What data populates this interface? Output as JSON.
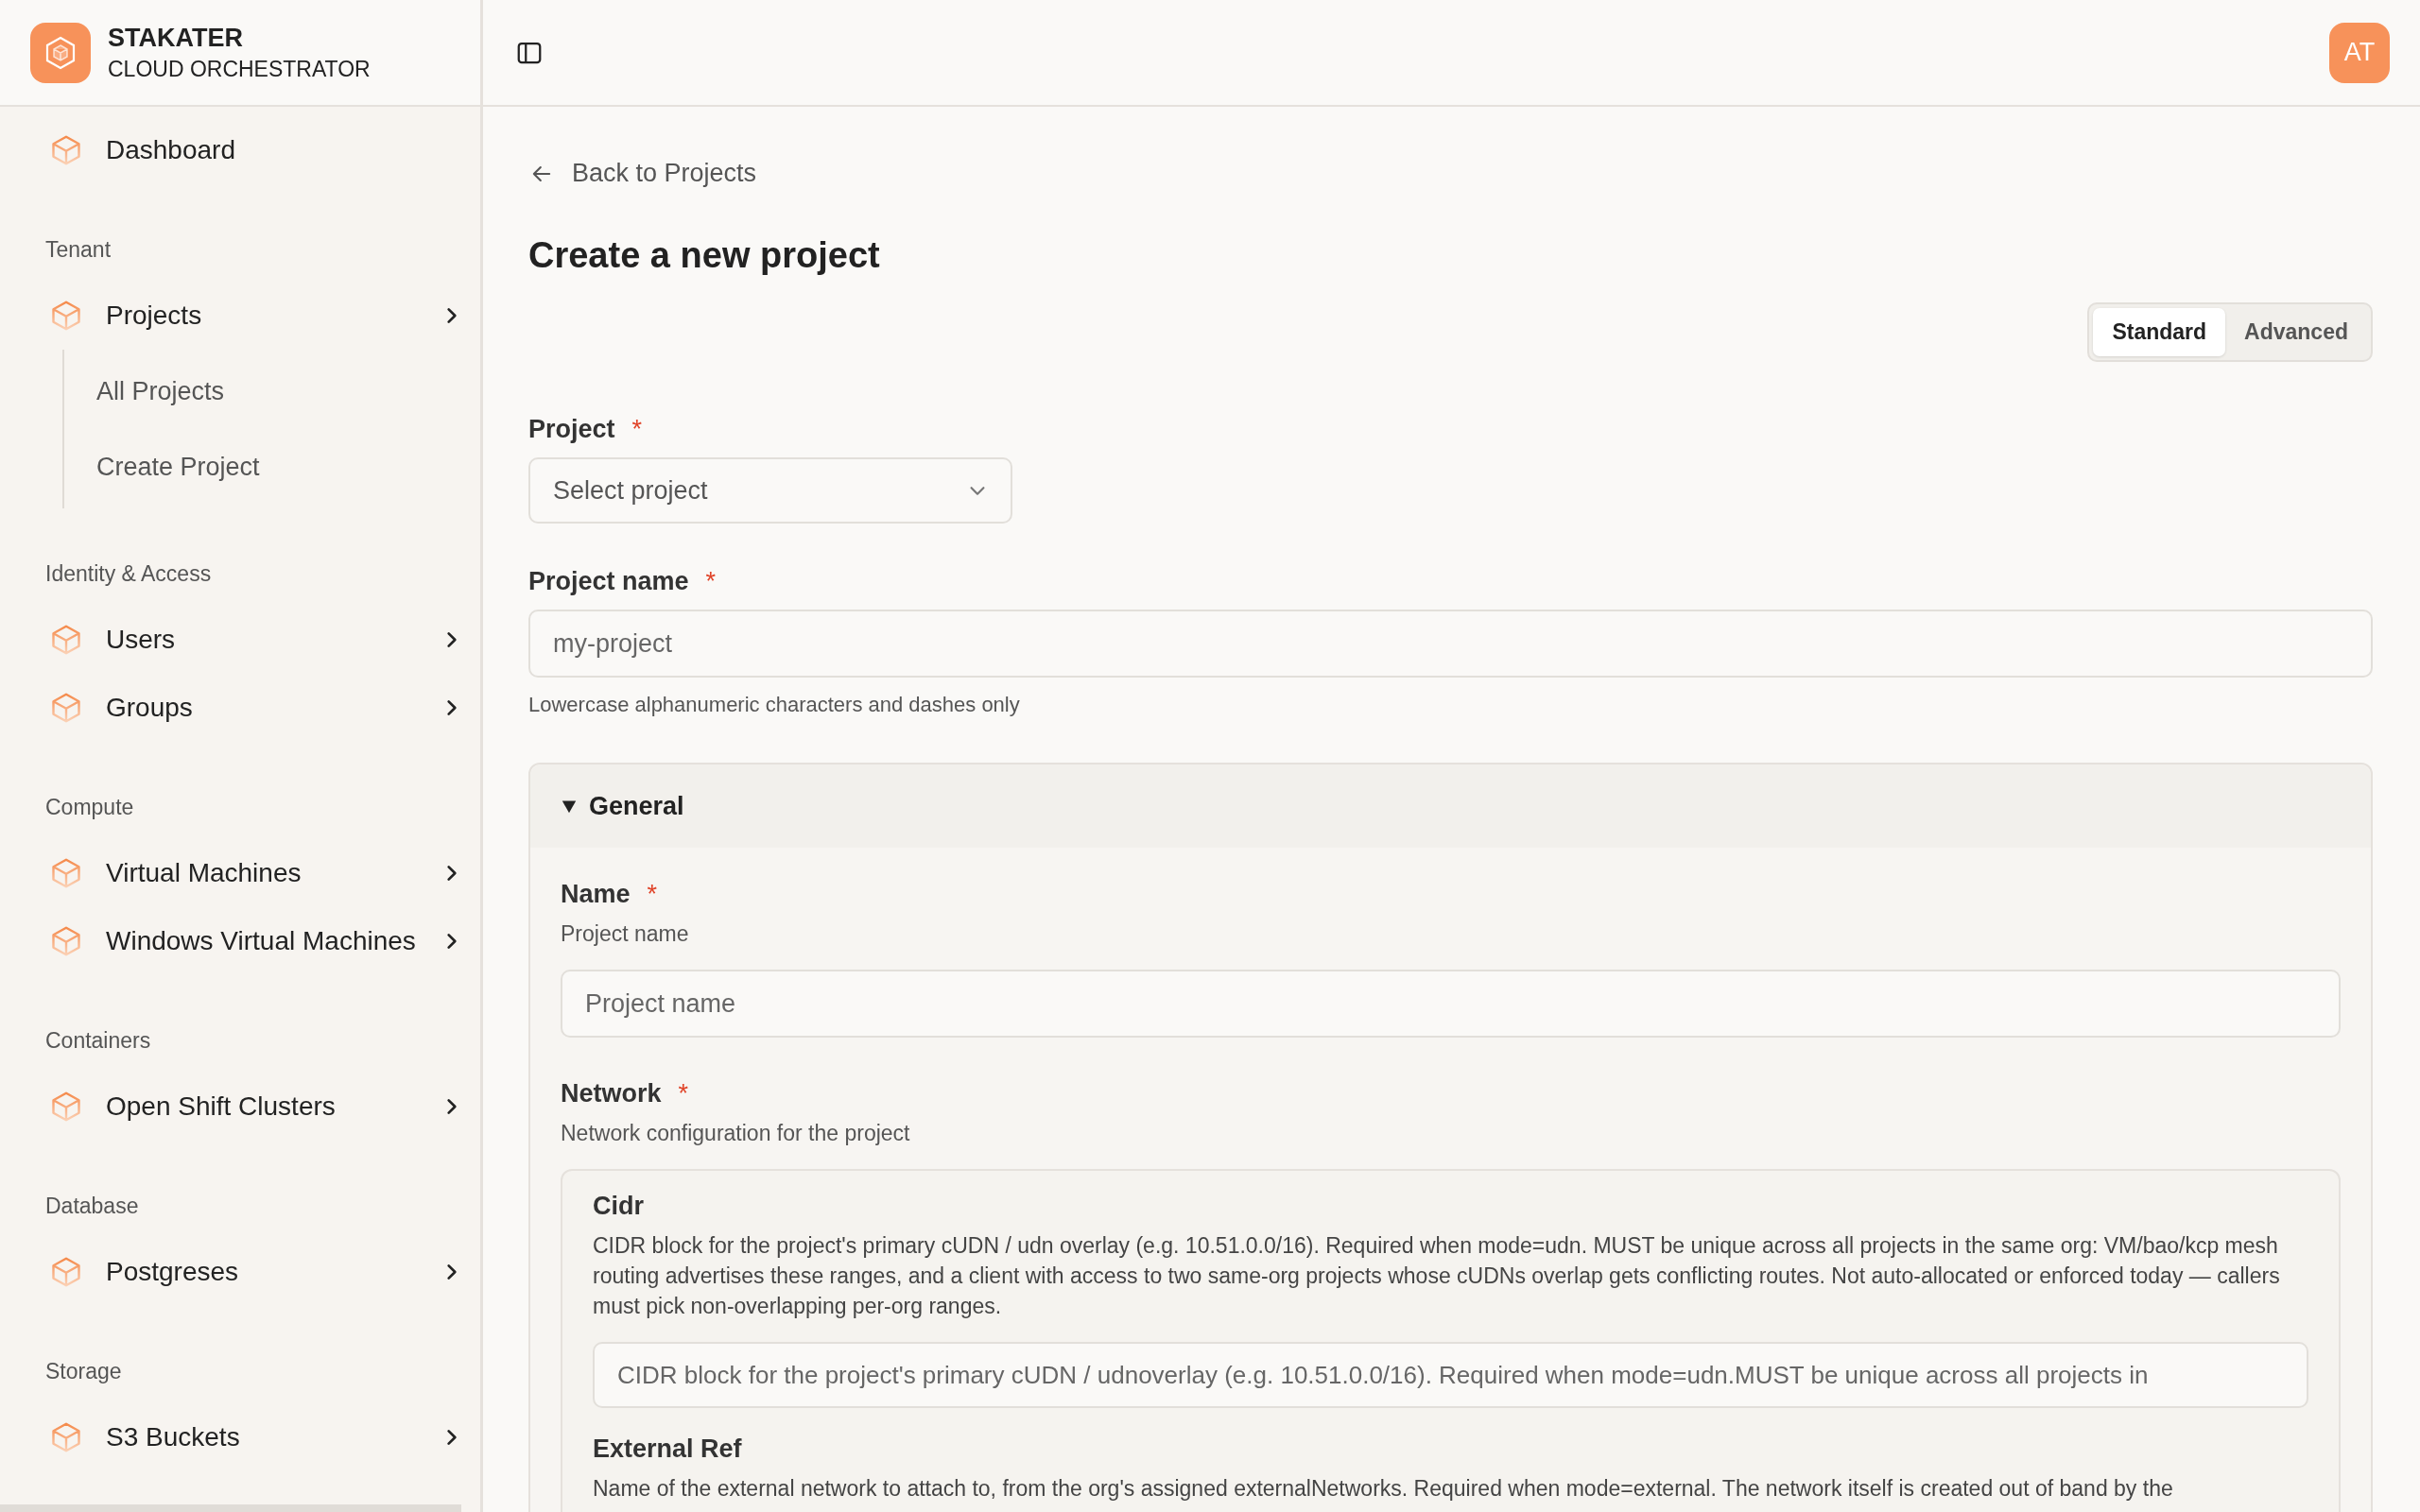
{
  "brand": {
    "title": "STAKATER",
    "subtitle": "CLOUD ORCHESTRATOR"
  },
  "avatar": {
    "initials": "AT"
  },
  "sidebar": {
    "sections": [
      {
        "items": [
          {
            "label": "Dashboard",
            "kind": "link"
          }
        ]
      },
      {
        "label": "Tenant",
        "items": [
          {
            "label": "Projects",
            "kind": "menu",
            "children": [
              {
                "label": "All Projects"
              },
              {
                "label": "Create Project"
              }
            ]
          }
        ]
      },
      {
        "label": "Identity & Access",
        "items": [
          {
            "label": "Users",
            "kind": "menu"
          },
          {
            "label": "Groups",
            "kind": "menu"
          }
        ]
      },
      {
        "label": "Compute",
        "items": [
          {
            "label": "Virtual Machines",
            "kind": "menu"
          },
          {
            "label": "Windows Virtual Machines",
            "kind": "menu"
          }
        ]
      },
      {
        "label": "Containers",
        "items": [
          {
            "label": "Open Shift Clusters",
            "kind": "menu"
          }
        ]
      },
      {
        "label": "Database",
        "items": [
          {
            "label": "Postgreses",
            "kind": "menu"
          }
        ]
      },
      {
        "label": "Storage",
        "items": [
          {
            "label": "S3 Buckets",
            "kind": "menu"
          }
        ]
      }
    ]
  },
  "back_link": "Back to Projects",
  "page_title": "Create a new project",
  "mode_tabs": [
    {
      "label": "Standard",
      "selected": true
    },
    {
      "label": "Advanced",
      "selected": false
    }
  ],
  "project_field": {
    "label": "Project",
    "required_mark": "*",
    "placeholder": "Select project"
  },
  "project_name_field": {
    "label": "Project name",
    "required_mark": "*",
    "placeholder": "my-project",
    "hint": "Lowercase alphanumeric characters and dashes only"
  },
  "general": {
    "title": "General",
    "expanded": true,
    "name_field": {
      "label": "Name",
      "required_mark": "*",
      "description": "Project name",
      "placeholder": "Project name"
    },
    "network": {
      "label": "Network",
      "required_mark": "*",
      "description": "Network configuration for the project",
      "fields": [
        {
          "label": "Cidr",
          "description": "CIDR block for the project's primary cUDN / udn overlay (e.g. 10.51.0.0/16). Required when mode=udn. MUST be unique across all projects in the same org: VM/bao/kcp mesh routing advertises these ranges, and a client with access to two same-org projects whose cUDNs overlap gets conflicting routes. Not auto-allocated or enforced today — callers must pick non-overlapping per-org ranges.",
          "placeholder": "CIDR block for the project's primary cUDN / udnoverlay (e.g. 10.51.0.0/16). Required when mode=udn.MUST be unique across all projects in"
        },
        {
          "label": "External Ref",
          "description": "Name of the external network to attach to, from the org's assigned externalNetworks. Required when mode=external. The network itself is created out of band by the"
        }
      ]
    }
  }
}
